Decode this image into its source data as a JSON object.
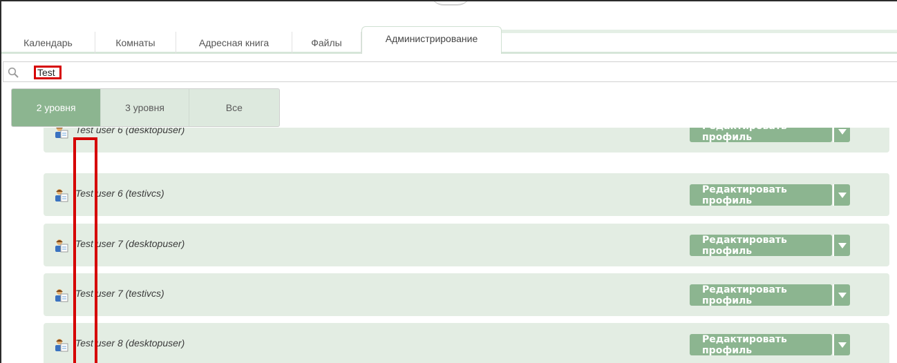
{
  "tabs": [
    {
      "label": "Календарь"
    },
    {
      "label": "Комнаты"
    },
    {
      "label": "Адресная книга"
    },
    {
      "label": "Файлы"
    },
    {
      "label": "Администрирование"
    }
  ],
  "active_tab": "Администрирование",
  "search": {
    "value": "Test",
    "icon": "search-icon"
  },
  "levels": [
    {
      "label": "2 уровня",
      "active": true
    },
    {
      "label": "3 уровня",
      "active": false
    },
    {
      "label": "Все",
      "active": false
    }
  ],
  "rows": [
    {
      "name": "Test user 6 (desktopuser)",
      "action": "Редактировать профиль"
    },
    {
      "name": "Test user 6 (testivcs)",
      "action": "Редактировать профиль"
    },
    {
      "name": "Test user 7 (desktopuser)",
      "action": "Редактировать профиль"
    },
    {
      "name": "Test user 7 (testivcs)",
      "action": "Редактировать профиль"
    },
    {
      "name": "Test user 8 (desktopuser)",
      "action": "Редактировать профиль"
    }
  ],
  "colors": {
    "accent": "#8cb590",
    "row_bg": "#e3ede3",
    "highlight": "#d60000"
  }
}
